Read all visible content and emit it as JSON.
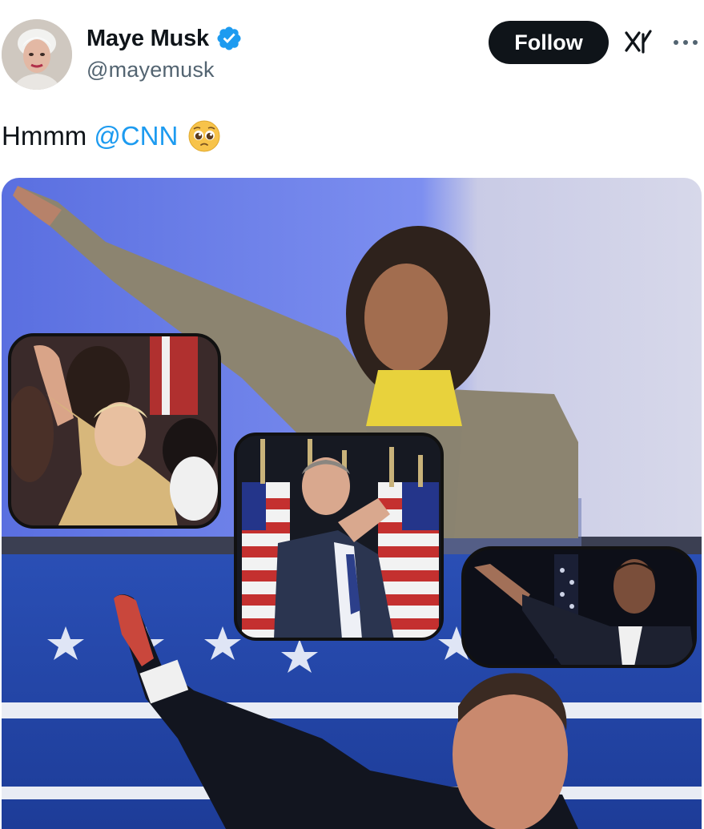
{
  "post": {
    "author": {
      "display_name": "Maye Musk",
      "handle": "@mayemusk",
      "verified": true,
      "avatar_icon": "profile-avatar"
    },
    "follow_label": "Follow",
    "text": "Hmmm",
    "mention": "@CNN",
    "emoji": "pleading-face-emoji",
    "toolbar_icons": [
      "grok-icon",
      "more-icon"
    ]
  },
  "media": {
    "type": "photo-collage",
    "panels": 5
  },
  "colors": {
    "primary_text": "#0f1419",
    "secondary_text": "#536471",
    "accent": "#1d9bf0",
    "follow_button_bg": "#0f1419",
    "follow_button_text": "#ffffff"
  }
}
